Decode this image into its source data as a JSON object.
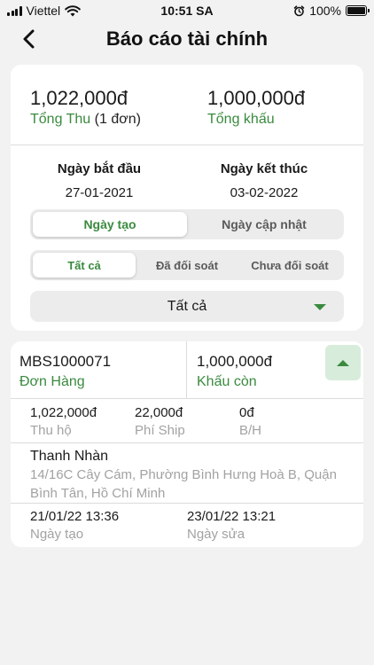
{
  "status_bar": {
    "carrier": "Viettel",
    "time": "10:51 SA",
    "battery": "100%"
  },
  "header": {
    "title": "Báo cáo tài chính",
    "back_icon": "chevron-left-icon"
  },
  "summary": {
    "total_in": "1,022,000đ",
    "total_in_label": "Tổng Thu",
    "total_in_count": "(1 đơn)",
    "total_deduct": "1,000,000đ",
    "total_deduct_label": "Tổng khấu"
  },
  "dates": {
    "start_label": "Ngày bắt đầu",
    "start_value": "27-01-2021",
    "end_label": "Ngày kết thúc",
    "end_value": "03-02-2022"
  },
  "date_type_tabs": [
    {
      "label": "Ngày tạo",
      "active": true
    },
    {
      "label": "Ngày cập nhật",
      "active": false
    }
  ],
  "reconcile_tabs": [
    {
      "label": "Tất cả",
      "active": true
    },
    {
      "label": "Đã đối soát",
      "active": false
    },
    {
      "label": "Chưa đối soát",
      "active": false
    }
  ],
  "filter": {
    "selected": "Tất cả"
  },
  "order": {
    "code": "MBS1000071",
    "code_label": "Đơn Hàng",
    "remaining": "1,000,000đ",
    "remaining_label": "Khấu còn",
    "cod": "1,022,000đ",
    "cod_label": "Thu hộ",
    "ship_fee": "22,000đ",
    "ship_fee_label": "Phí Ship",
    "bh": "0đ",
    "bh_label": "B/H",
    "receiver_name": "Thanh Nhàn",
    "receiver_address": "14/16C Cây Cám, Phường Bình Hưng Hoà B, Quận Bình Tân, Hồ Chí Minh",
    "created": "21/01/22 13:36",
    "created_label": "Ngày tạo",
    "updated": "23/01/22 13:21",
    "updated_label": "Ngày sửa"
  },
  "colors": {
    "accent": "#3a8a3f",
    "accent_light": "#d8ecdb",
    "muted": "#a2a2a2"
  }
}
